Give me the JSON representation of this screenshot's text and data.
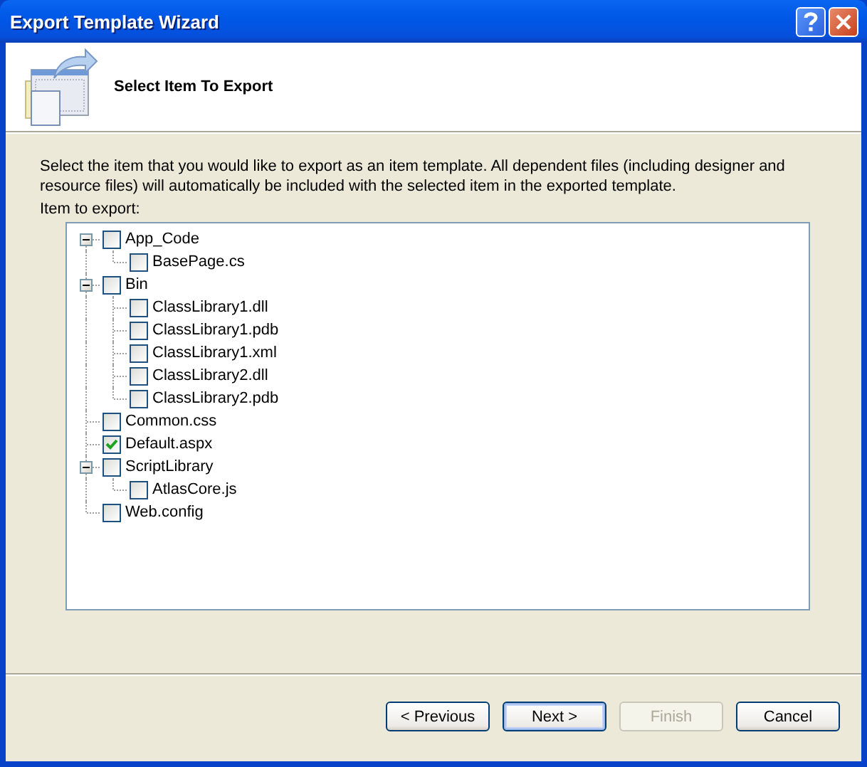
{
  "window": {
    "title": "Export Template Wizard"
  },
  "header": {
    "title": "Select Item To Export"
  },
  "description": "Select the item that you would like to export as an item template. All dependent files (including designer and resource files) will automatically be included with the selected item in the exported template.",
  "tree_label": "Item to export:",
  "tree": [
    {
      "label": "App_Code",
      "checked": false,
      "expanded": true,
      "children": [
        {
          "label": "BasePage.cs",
          "checked": false
        }
      ]
    },
    {
      "label": "Bin",
      "checked": false,
      "expanded": true,
      "children": [
        {
          "label": "ClassLibrary1.dll",
          "checked": false
        },
        {
          "label": "ClassLibrary1.pdb",
          "checked": false
        },
        {
          "label": "ClassLibrary1.xml",
          "checked": false
        },
        {
          "label": "ClassLibrary2.dll",
          "checked": false
        },
        {
          "label": "ClassLibrary2.pdb",
          "checked": false
        }
      ]
    },
    {
      "label": "Common.css",
      "checked": false
    },
    {
      "label": "Default.aspx",
      "checked": true
    },
    {
      "label": "ScriptLibrary",
      "checked": false,
      "expanded": true,
      "children": [
        {
          "label": "AtlasCore.js",
          "checked": false
        }
      ]
    },
    {
      "label": "Web.config",
      "checked": false
    }
  ],
  "buttons": [
    {
      "label": "< Previous",
      "disabled": false,
      "default": false
    },
    {
      "label": "Next >",
      "disabled": false,
      "default": true
    },
    {
      "label": "Finish",
      "disabled": true,
      "default": false
    },
    {
      "label": "Cancel",
      "disabled": false,
      "default": false
    }
  ]
}
